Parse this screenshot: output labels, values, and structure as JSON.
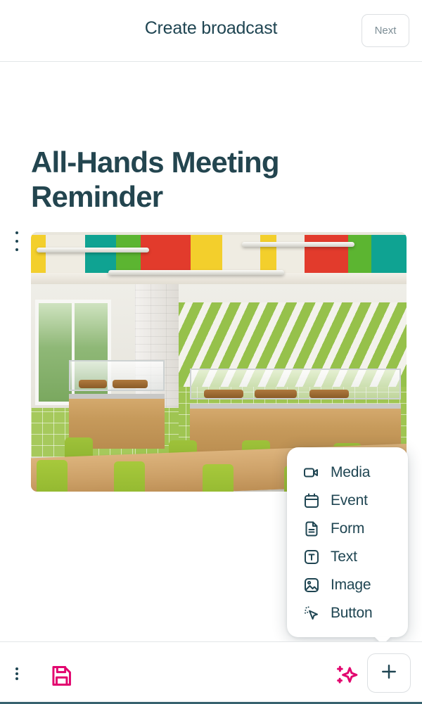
{
  "header": {
    "title": "Create broadcast",
    "next_label": "Next"
  },
  "content": {
    "doc_title": "All-Hands Meeting Reminder",
    "block_handle_icon": "drag-dots-icon",
    "image_alt": "cafeteria-interior-photo"
  },
  "add_menu": {
    "visible": true,
    "items": [
      {
        "label": "Media",
        "icon": "video-camera-icon"
      },
      {
        "label": "Event",
        "icon": "calendar-icon"
      },
      {
        "label": "Form",
        "icon": "document-icon"
      },
      {
        "label": "Text",
        "icon": "text-box-icon"
      },
      {
        "label": "Image",
        "icon": "image-icon"
      },
      {
        "label": "Button",
        "icon": "cursor-sparkle-icon"
      }
    ]
  },
  "toolbar": {
    "more_icon": "vertical-dots-icon",
    "save_icon": "floppy-save-icon",
    "ai_icon": "sparkle-ai-icon",
    "add_icon": "plus-icon"
  },
  "colors": {
    "brand_teal": "#1f4552",
    "accent_pink": "#e2066f",
    "muted_text": "#7d8e96",
    "border": "#dcdfe2",
    "surface": "#ffffff"
  }
}
